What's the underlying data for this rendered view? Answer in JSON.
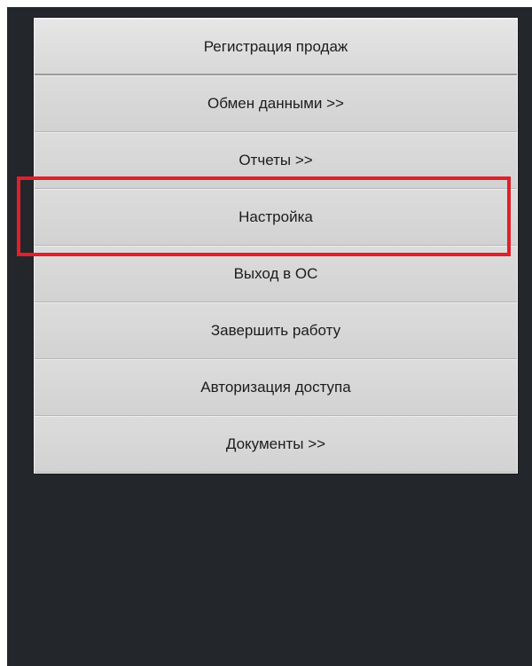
{
  "menu": {
    "items": [
      {
        "label": "Регистрация продаж"
      },
      {
        "label": "Обмен данными >>"
      },
      {
        "label": "Отчеты >>"
      },
      {
        "label": "Настройка"
      },
      {
        "label": "Выход в ОС"
      },
      {
        "label": "Завершить работу"
      },
      {
        "label": "Авторизация доступа"
      },
      {
        "label": "Документы >>"
      }
    ]
  },
  "highlight": {
    "target": "Настройка",
    "color": "#e0202a"
  },
  "colors": {
    "background": "#23262b",
    "menu_item": "#d6d6d6",
    "text": "#1c1c1c"
  }
}
